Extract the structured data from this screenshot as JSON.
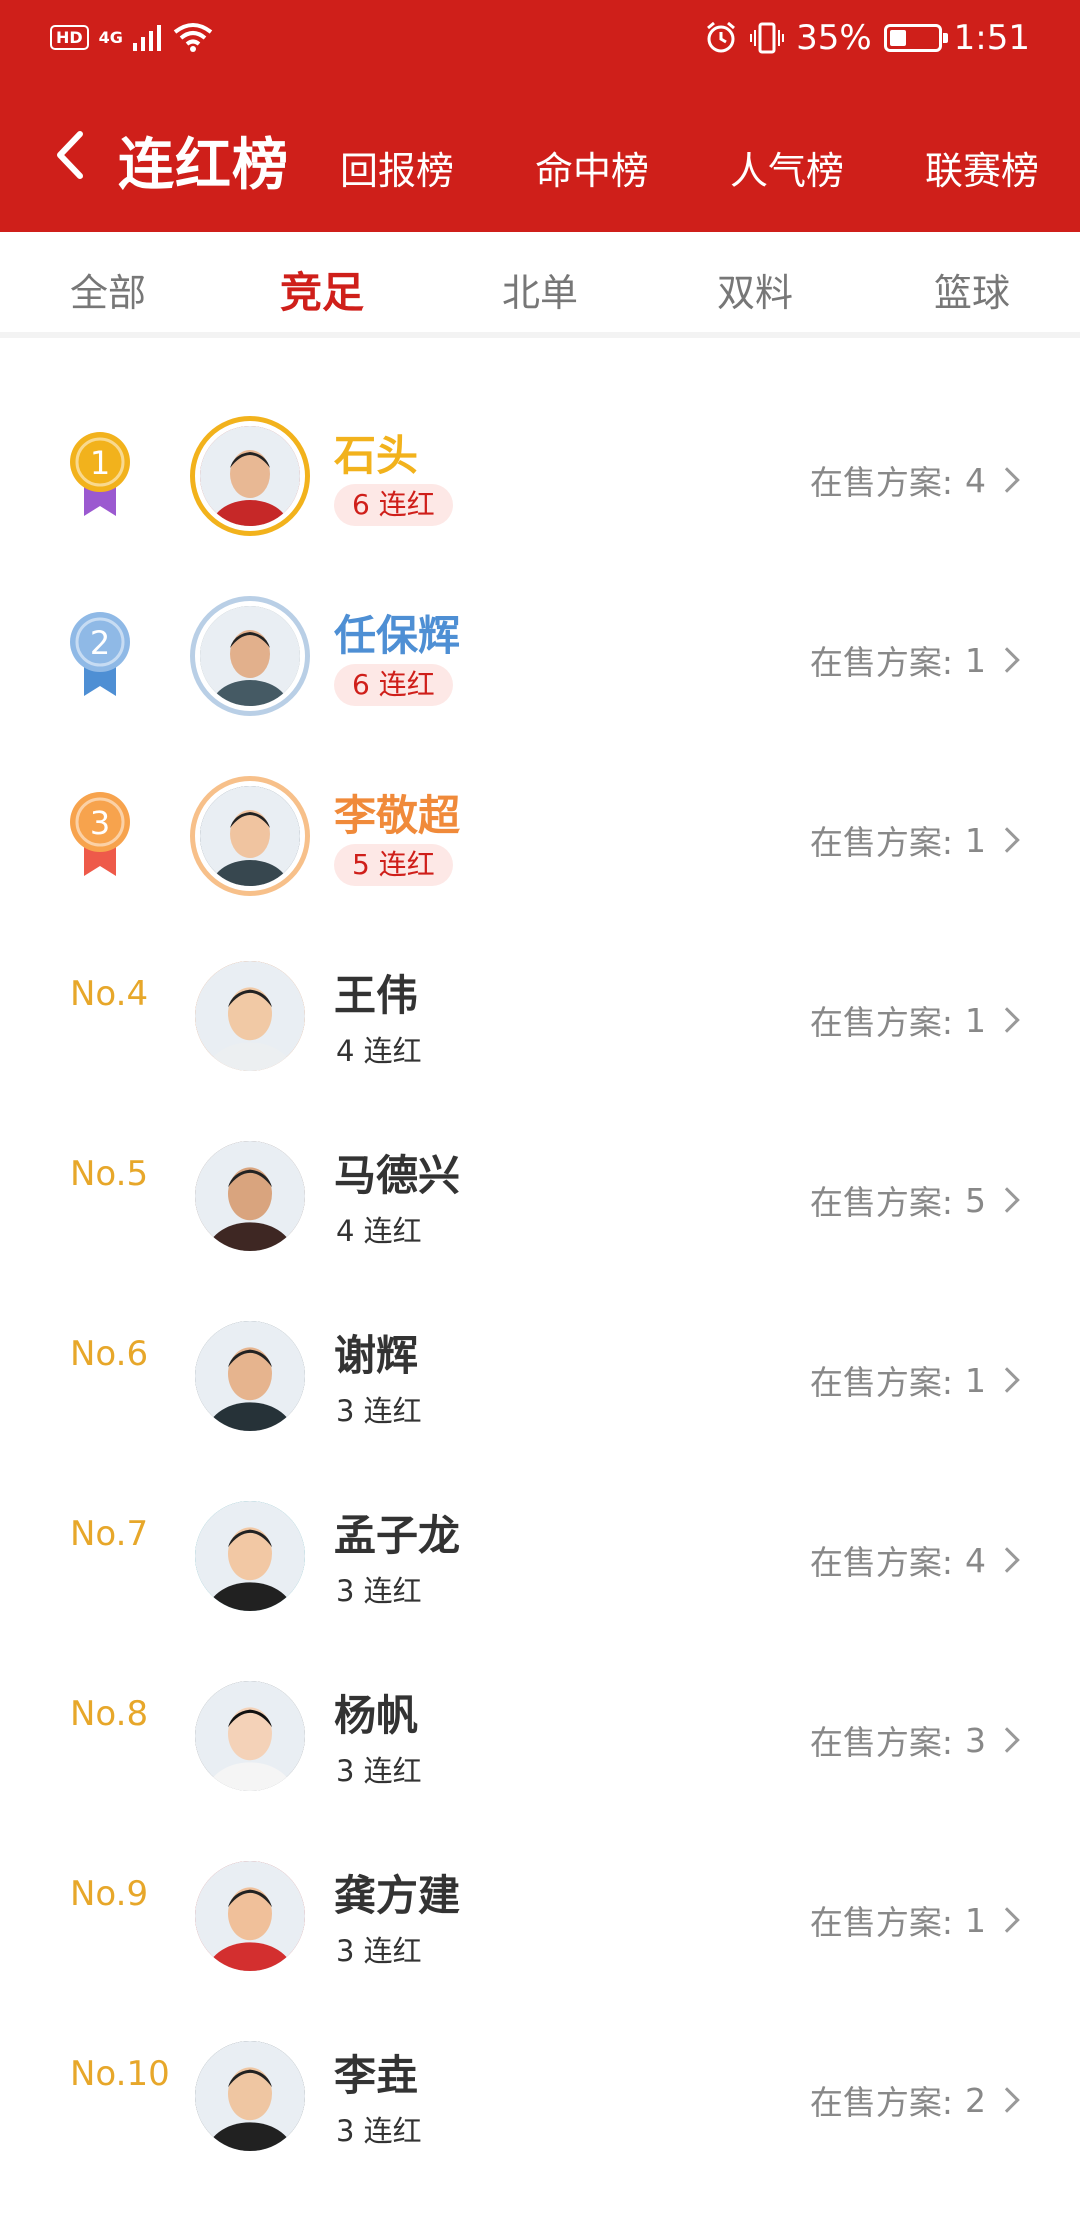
{
  "status_bar": {
    "hd": "HD",
    "network": "4G",
    "battery_percent": "35%",
    "time": "1:51",
    "icons": [
      "hd-icon",
      "signal-icon",
      "wifi-icon",
      "alarm-icon",
      "vibrate-icon",
      "battery-icon"
    ]
  },
  "header": {
    "title": "连红榜",
    "tabs": [
      "回报榜",
      "命中榜",
      "人气榜",
      "联赛榜"
    ]
  },
  "sub_tabs": {
    "items": [
      "全部",
      "竞足",
      "北单",
      "双料",
      "篮球"
    ],
    "active_index": 1
  },
  "colors": {
    "primary_red": "#cf1f1a",
    "gold": "#f2b21c",
    "silver_blue": "#4e8fd4",
    "bronze_orange": "#f08a3a",
    "rank_text": "#e7a72a"
  },
  "onsale_label": "在售方案:",
  "rankings": [
    {
      "rank": "1",
      "name": "石头",
      "streak": "6 连红",
      "onsale_count": "4"
    },
    {
      "rank": "2",
      "name": "任保辉",
      "streak": "6 连红",
      "onsale_count": "1"
    },
    {
      "rank": "3",
      "name": "李敬超",
      "streak": "5 连红",
      "onsale_count": "1"
    },
    {
      "rank": "No.4",
      "name": "王伟",
      "streak": "4 连红",
      "onsale_count": "1"
    },
    {
      "rank": "No.5",
      "name": "马德兴",
      "streak": "4 连红",
      "onsale_count": "5"
    },
    {
      "rank": "No.6",
      "name": "谢辉",
      "streak": "3 连红",
      "onsale_count": "1"
    },
    {
      "rank": "No.7",
      "name": "孟子龙",
      "streak": "3 连红",
      "onsale_count": "4"
    },
    {
      "rank": "No.8",
      "name": "杨帆",
      "streak": "3 连红",
      "onsale_count": "3"
    },
    {
      "rank": "No.9",
      "name": "龚方建",
      "streak": "3 连红",
      "onsale_count": "1"
    },
    {
      "rank": "No.10",
      "name": "李垚",
      "streak": "3 连红",
      "onsale_count": "2"
    }
  ]
}
